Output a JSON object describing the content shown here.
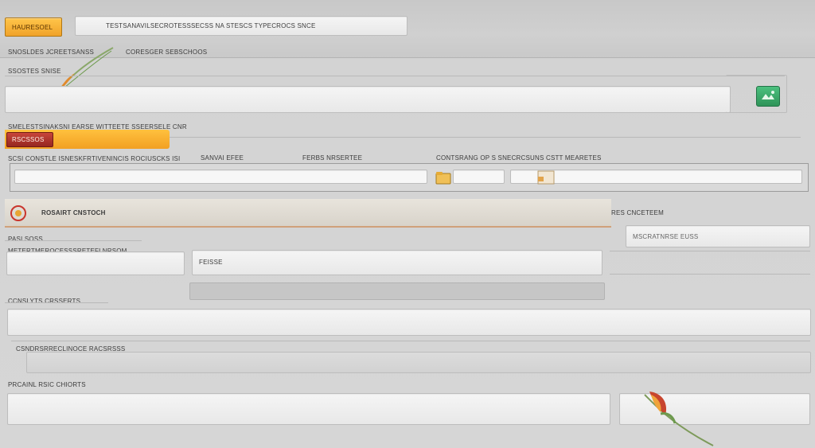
{
  "header": {
    "orange_button": "HAURESOEL",
    "title_bar": "TESTSANAVILSECROTESSSECSS NA STESCS TYPECROCS SNCE",
    "subtitle": "CORESGER SEBSCHOOS",
    "left_caption": "SNOSLDES JCREETSANSS"
  },
  "section1": {
    "label": "SSOSTES SNISE",
    "input_value": ""
  },
  "section2": {
    "label": "SMELESTSINAKSNI EARSE WITTEETE SSEERSELE CNR",
    "tab": "RSCSSOS",
    "col1": "SCSI CONSTLE ISNESKFRTIVENINCIS ROCIUSCKS ISI",
    "col2": "SANVAI EFEE",
    "col3": "FERBS NRSERTEE",
    "col4": "CONTSRANG OP S SNECRCSUNS CSTT MEARETES",
    "field1": "",
    "field2": "",
    "field3": ""
  },
  "section3": {
    "title": "ROSAIRT CNSTOCH",
    "right_label": "RES CNCETEEM",
    "right_input": "MSCRATNRSE EUSS"
  },
  "section4": {
    "label": "PASI SOSS",
    "sublabel": "METERTMEROCESSSRETEFLNRSOM.",
    "field2": "FEISSE"
  },
  "section5": {
    "label": "CCNSLYTS CRSSERTS"
  },
  "section6": {
    "label": "CSNDRSRRECLINOCE RACSRSSS"
  },
  "section7": {
    "label": "PRCAINL RSIC CHIORTS"
  },
  "colors": {
    "orange": "#f0a32a",
    "red_tab": "#b5312a",
    "green_icon": "#3aa86b"
  }
}
